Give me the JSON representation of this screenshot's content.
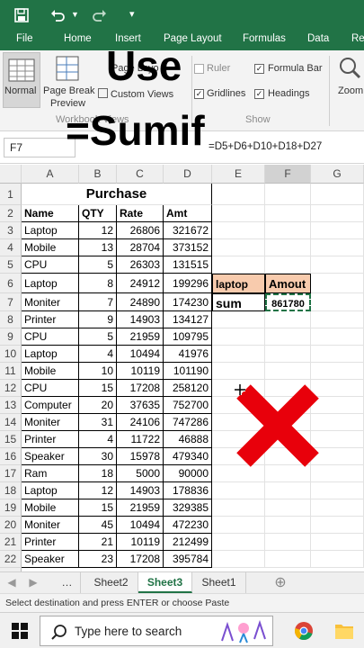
{
  "qat": {
    "save_icon": "save-icon",
    "undo_icon": "undo-icon",
    "customize_icon": "customize-qat-icon"
  },
  "ribbon_tabs": [
    "File",
    "Home",
    "Insert",
    "Page Layout",
    "Formulas",
    "Data",
    "Re"
  ],
  "ribbon": {
    "normal_label": "Normal",
    "page_break_label_1": "Page Break",
    "page_break_label_2": "Preview",
    "page_layout_label": "Page Layo",
    "custom_views_label": "Custom Views",
    "workbook_views_group": "Workbook Views",
    "ruler_label": "Ruler",
    "formula_bar_label": "Formula Bar",
    "gridlines_label": "Gridlines",
    "headings_label": "Headings",
    "show_group": "Show",
    "zoom_label": "Zoom"
  },
  "overlay": {
    "line1": "Use",
    "line2": "=Sumif"
  },
  "formula_bar": {
    "name_box": "F7",
    "formula": "=D5+D6+D10+D18+D27"
  },
  "columns": [
    "A",
    "B",
    "C",
    "D",
    "E",
    "F",
    "G"
  ],
  "header_row": {
    "title": "Purchase",
    "name": "Name",
    "qty": "QTY",
    "rate": "Rate",
    "amt": "Amt"
  },
  "rows": [
    {
      "n": "3",
      "name": "Laptop",
      "qty": "12",
      "rate": "26806",
      "amt": "321672"
    },
    {
      "n": "4",
      "name": "Mobile",
      "qty": "13",
      "rate": "28704",
      "amt": "373152"
    },
    {
      "n": "5",
      "name": "CPU",
      "qty": "5",
      "rate": "26303",
      "amt": "131515"
    },
    {
      "n": "6",
      "name": "Laptop",
      "qty": "8",
      "rate": "24912",
      "amt": "199296"
    },
    {
      "n": "7",
      "name": "Moniter",
      "qty": "7",
      "rate": "24890",
      "amt": "174230"
    },
    {
      "n": "8",
      "name": "Printer",
      "qty": "9",
      "rate": "14903",
      "amt": "134127"
    },
    {
      "n": "9",
      "name": "CPU",
      "qty": "5",
      "rate": "21959",
      "amt": "109795"
    },
    {
      "n": "10",
      "name": "Laptop",
      "qty": "4",
      "rate": "10494",
      "amt": "41976"
    },
    {
      "n": "11",
      "name": "Mobile",
      "qty": "10",
      "rate": "10119",
      "amt": "101190"
    },
    {
      "n": "12",
      "name": "CPU",
      "qty": "15",
      "rate": "17208",
      "amt": "258120"
    },
    {
      "n": "13",
      "name": "Computer",
      "qty": "20",
      "rate": "37635",
      "amt": "752700"
    },
    {
      "n": "14",
      "name": "Moniter",
      "qty": "31",
      "rate": "24106",
      "amt": "747286"
    },
    {
      "n": "15",
      "name": "Printer",
      "qty": "4",
      "rate": "11722",
      "amt": "46888"
    },
    {
      "n": "16",
      "name": "Speaker",
      "qty": "30",
      "rate": "15978",
      "amt": "479340"
    },
    {
      "n": "17",
      "name": "Ram",
      "qty": "18",
      "rate": "5000",
      "amt": "90000"
    },
    {
      "n": "18",
      "name": "Laptop",
      "qty": "12",
      "rate": "14903",
      "amt": "178836"
    },
    {
      "n": "19",
      "name": "Mobile",
      "qty": "15",
      "rate": "21959",
      "amt": "329385"
    },
    {
      "n": "20",
      "name": "Moniter",
      "qty": "45",
      "rate": "10494",
      "amt": "472230"
    },
    {
      "n": "21",
      "name": "Printer",
      "qty": "21",
      "rate": "10119",
      "amt": "212499"
    },
    {
      "n": "22",
      "name": "Speaker",
      "qty": "23",
      "rate": "17208",
      "amt": "395784"
    }
  ],
  "side_table": {
    "e6": "laptop",
    "f6": "Amout",
    "e7": "sum",
    "f7": "861780"
  },
  "sheet_tabs": [
    "Sheet2",
    "Sheet3",
    "Sheet1"
  ],
  "status_text": "Select destination and press ENTER or choose Paste",
  "taskbar": {
    "search_placeholder": "Type here to search"
  },
  "colors": {
    "excel_green": "#217346",
    "side_header_fill": "#f8cbad",
    "cross_red": "#e8000b"
  }
}
